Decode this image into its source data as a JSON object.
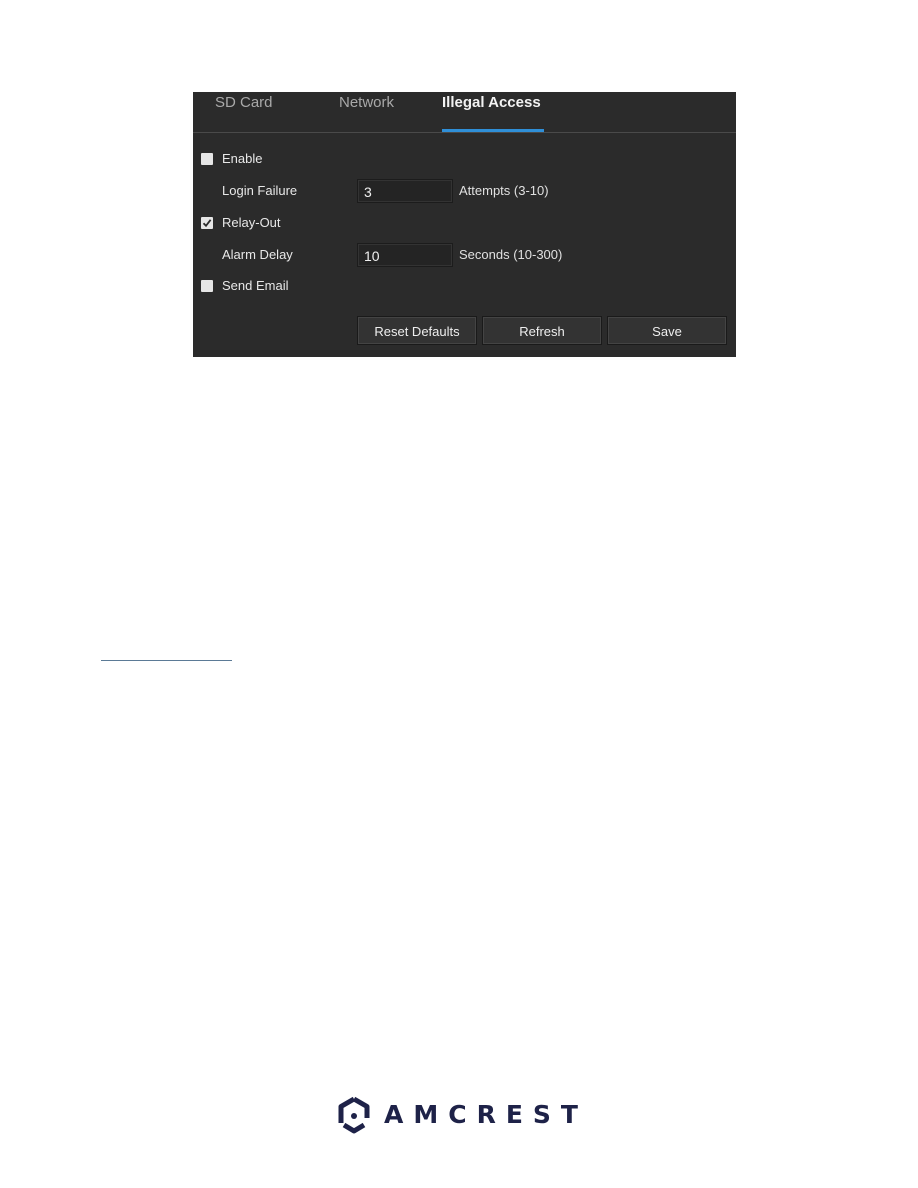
{
  "tabs": [
    {
      "label": "SD Card",
      "active": false
    },
    {
      "label": "Network",
      "active": false
    },
    {
      "label": "Illegal Access",
      "active": true
    }
  ],
  "form": {
    "enable": {
      "label": "Enable",
      "checked": false
    },
    "login_failure": {
      "label": "Login Failure",
      "value": "3",
      "unit": "Attempts (3-10)"
    },
    "relay_out": {
      "label": "Relay-Out",
      "checked": true
    },
    "alarm_delay": {
      "label": "Alarm Delay",
      "value": "10",
      "unit": "Seconds (10-300)"
    },
    "send_email": {
      "label": "Send Email",
      "checked": false
    }
  },
  "buttons": {
    "reset_defaults": "Reset Defaults",
    "refresh": "Refresh",
    "save": "Save"
  },
  "colors": {
    "panel_bg": "#2b2b2b",
    "tab_accent": "#2f8fd8",
    "brand": "#1e2248"
  },
  "footer": {
    "brand": "AMCREST"
  }
}
